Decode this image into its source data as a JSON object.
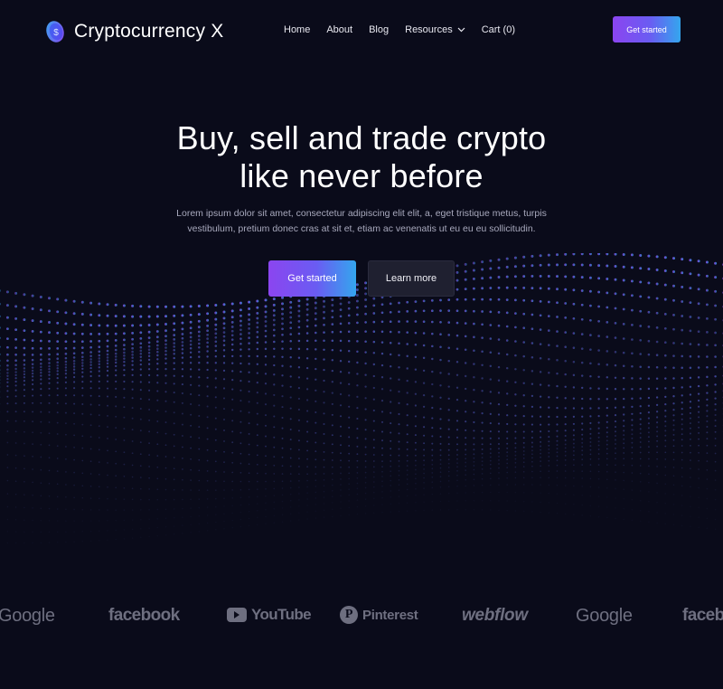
{
  "header": {
    "brand": {
      "name": "Cryptocurrency X",
      "icon": "coin-icon"
    },
    "nav": [
      {
        "label": "Home"
      },
      {
        "label": "About"
      },
      {
        "label": "Blog"
      },
      {
        "label": "Resources",
        "icon": "chevron-down-icon"
      },
      {
        "label": "Cart (0)"
      }
    ],
    "cta_label": "Get started"
  },
  "hero": {
    "title_line1": "Buy, sell and trade crypto",
    "title_line2": "like never before",
    "text": "Lorem ipsum dolor sit amet, consectetur adipiscing elit elit, a, eget tristique metus, turpis vestibulum, pretium donec cras at sit et, etiam ac venenatis ut eu eu eu sollicitudin.",
    "primary_label": "Get started",
    "secondary_label": "Learn more"
  },
  "logos": {
    "items": [
      "Google",
      "facebook",
      "YouTube",
      "Pinterest",
      "webflow",
      "Google",
      "facebook"
    ]
  },
  "colors": {
    "background": "#0a0b1a",
    "gradient_start": "#8b45f0",
    "gradient_end": "#34a6ee",
    "logo_gray": "#6e6f80"
  }
}
